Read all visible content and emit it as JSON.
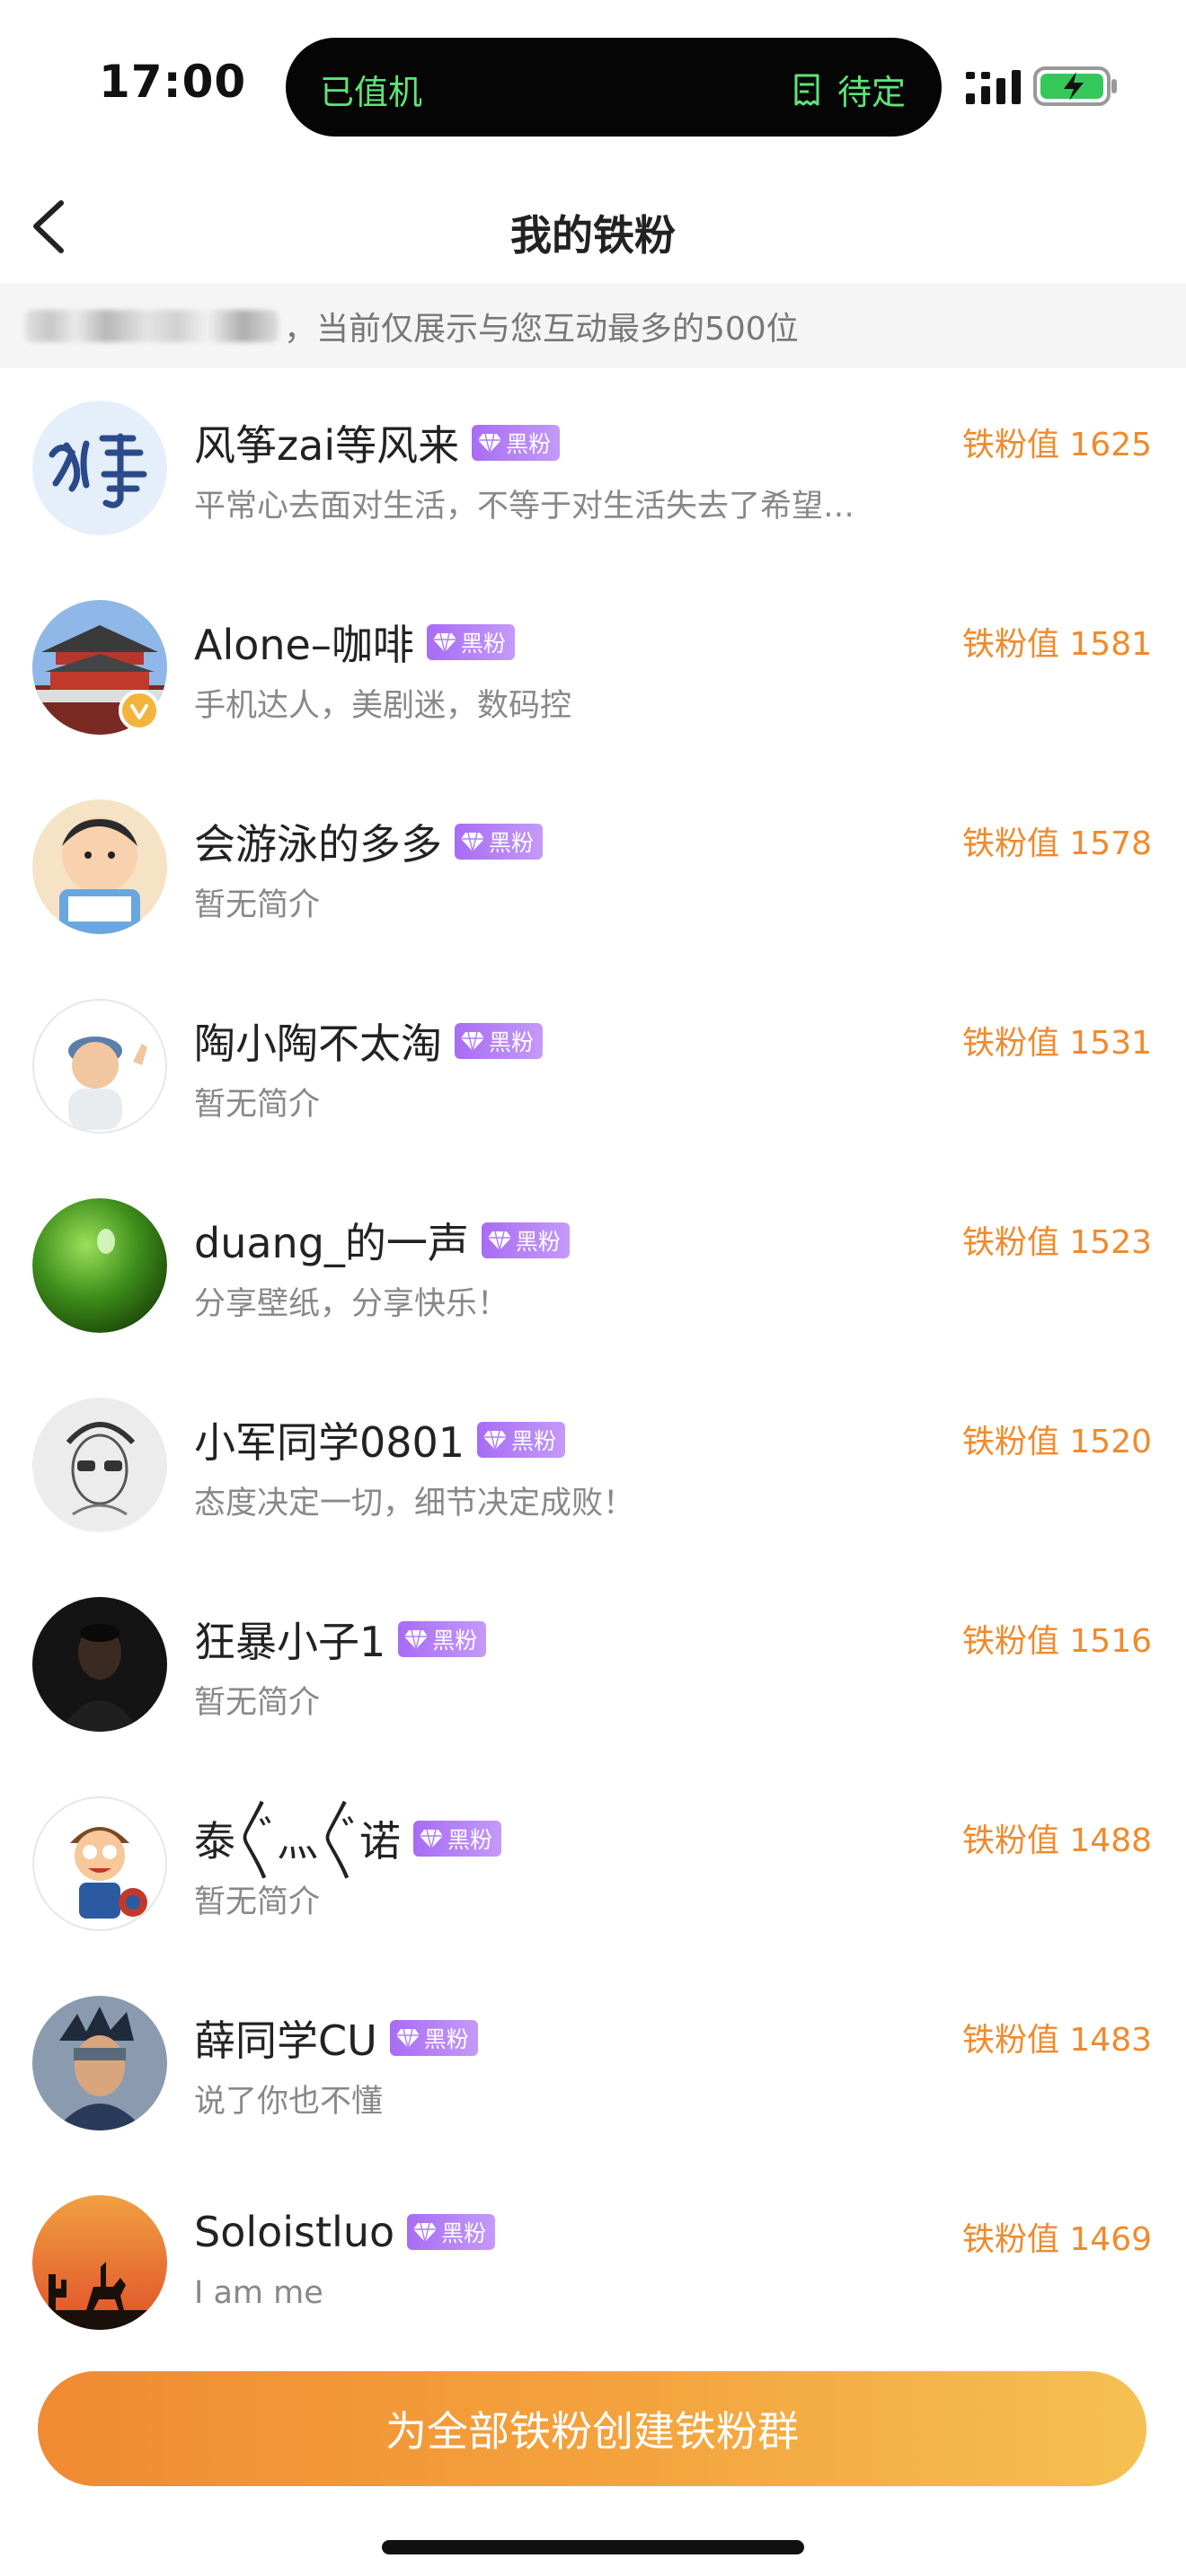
{
  "status_bar": {
    "time": "17:00",
    "island_left": "已值机",
    "island_right": "待定"
  },
  "header": {
    "title": "我的铁粉"
  },
  "notice": {
    "text": "，当前仅展示与您互动最多的500位"
  },
  "colors": {
    "accent": "#f08a2c",
    "badge": "#a86cf4",
    "island_text": "#5fe37a"
  },
  "fans": [
    {
      "name": "风筝zai等风来",
      "badge": "黑粉",
      "bio": "平常心去面对生活，不等于对生活失去了希望…",
      "score": "铁粉值 1625",
      "avatar": "calligraphy-avatar"
    },
    {
      "name": "Alone–咖啡",
      "badge": "黑粉",
      "bio": "手机达人，美剧迷，数码控",
      "score": "铁粉值 1581",
      "avatar": "palace-avatar",
      "verified": true
    },
    {
      "name": "会游泳的多多",
      "badge": "黑粉",
      "bio": "暂无简介",
      "score": "铁粉值 1578",
      "avatar": "cartoon-boy-avatar"
    },
    {
      "name": "陶小陶不太淘",
      "badge": "黑粉",
      "bio": "暂无简介",
      "score": "铁粉值 1531",
      "avatar": "memoji-avatar"
    },
    {
      "name": "duang_的一声",
      "badge": "黑粉",
      "bio": "分享壁纸，分享快乐！",
      "score": "铁粉值 1523",
      "avatar": "green-sphere-avatar"
    },
    {
      "name": "小军同学0801",
      "badge": "黑粉",
      "bio": "态度决定一切，细节决定成败！",
      "score": "铁粉值 1520",
      "avatar": "sketch-man-avatar"
    },
    {
      "name": "狂暴小子1",
      "badge": "黑粉",
      "bio": "暂无简介",
      "score": "铁粉值 1516",
      "avatar": "dark-photo-avatar"
    },
    {
      "name": "泰〲灬〲诺",
      "badge": "黑粉",
      "bio": "暂无简介",
      "score": "铁粉值 1488",
      "avatar": "cartoon-hero-avatar"
    },
    {
      "name": "薛同学CU",
      "badge": "黑粉",
      "bio": "说了你也不懂",
      "score": "铁粉值 1483",
      "avatar": "anime-ninja-avatar"
    },
    {
      "name": "Soloistluo",
      "badge": "黑粉",
      "bio": "I am me",
      "score": "铁粉值 1469",
      "avatar": "sunset-rider-avatar"
    }
  ],
  "bottom": {
    "button_label": "为全部铁粉创建铁粉群"
  }
}
